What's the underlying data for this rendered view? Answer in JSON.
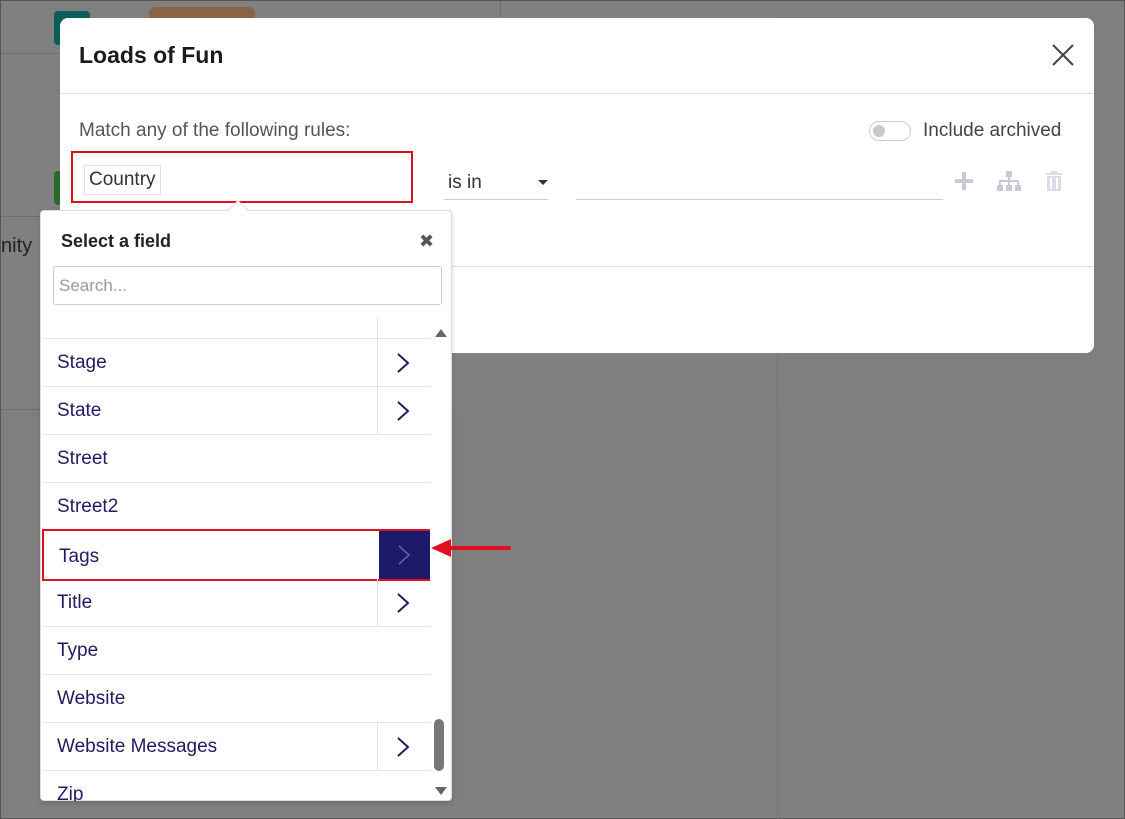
{
  "background": {
    "partial_text": "nity"
  },
  "modal": {
    "title": "Loads of Fun",
    "match_label": "Match any of the following rules:",
    "include_archived_label": "Include archived",
    "include_archived_on": false,
    "rule": {
      "field": "Country",
      "operator": "is in",
      "value": ""
    },
    "icons": [
      "close-icon",
      "plus-icon",
      "hierarchy-icon",
      "trash-icon"
    ]
  },
  "field_picker": {
    "title": "Select a field",
    "search_placeholder": "Search...",
    "items": [
      {
        "label": "Stage",
        "has_children": true
      },
      {
        "label": "State",
        "has_children": true
      },
      {
        "label": "Street",
        "has_children": false
      },
      {
        "label": "Street2",
        "has_children": false
      },
      {
        "label": "Tags",
        "has_children": true,
        "highlighted": true
      },
      {
        "label": "Title",
        "has_children": true
      },
      {
        "label": "Type",
        "has_children": false
      },
      {
        "label": "Website",
        "has_children": false
      },
      {
        "label": "Website Messages",
        "has_children": true
      },
      {
        "label": "Zip",
        "has_children": false
      }
    ]
  },
  "colors": {
    "highlight": "#e01020",
    "active_arrow_bg": "#1d1a6b",
    "item_text": "#1e1b63",
    "overlay": "#7f7f7f"
  }
}
